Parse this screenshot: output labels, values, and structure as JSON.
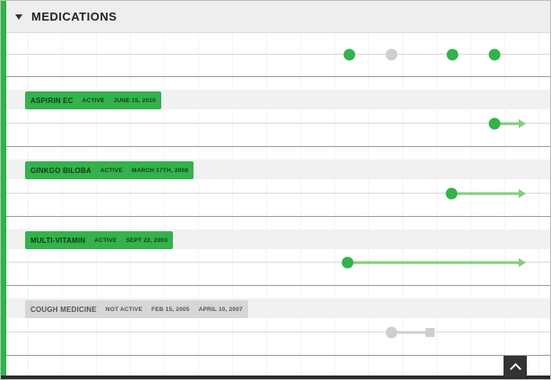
{
  "section": {
    "title": "MEDICATIONS",
    "collapse_icon": "caret-down-icon"
  },
  "colors": {
    "active": "#34b24b",
    "timeline_active": "#7fcf7a",
    "inactive": "#d6d6d6",
    "timeline_inactive": "#cfcfcf",
    "accent": "#2fb34a"
  },
  "summary_markers": [
    {
      "status": "active"
    },
    {
      "status": "inactive"
    },
    {
      "status": "active"
    },
    {
      "status": "active"
    }
  ],
  "medications": [
    {
      "name": "ASPIRIN EC",
      "status": "ACTIVE",
      "start": "JUNE 15, 2010",
      "end": "",
      "state": "active",
      "ongoing": true
    },
    {
      "name": "GINKGO BILOBA",
      "status": "ACTIVE",
      "start": "MARCH 17TH, 2008",
      "end": "",
      "state": "active",
      "ongoing": true
    },
    {
      "name": "MULTI-VITAMIN",
      "status": "ACTIVE",
      "start": "SEPT 22, 2003",
      "end": "",
      "state": "active",
      "ongoing": true
    },
    {
      "name": "COUGH MEDICINE",
      "status": "NOT ACTIVE",
      "start": "FEB 15, 2005",
      "end": "APRIL 10, 2007",
      "state": "inactive",
      "ongoing": false
    }
  ],
  "controls": {
    "scroll_top_icon": "chevron-up-icon"
  }
}
